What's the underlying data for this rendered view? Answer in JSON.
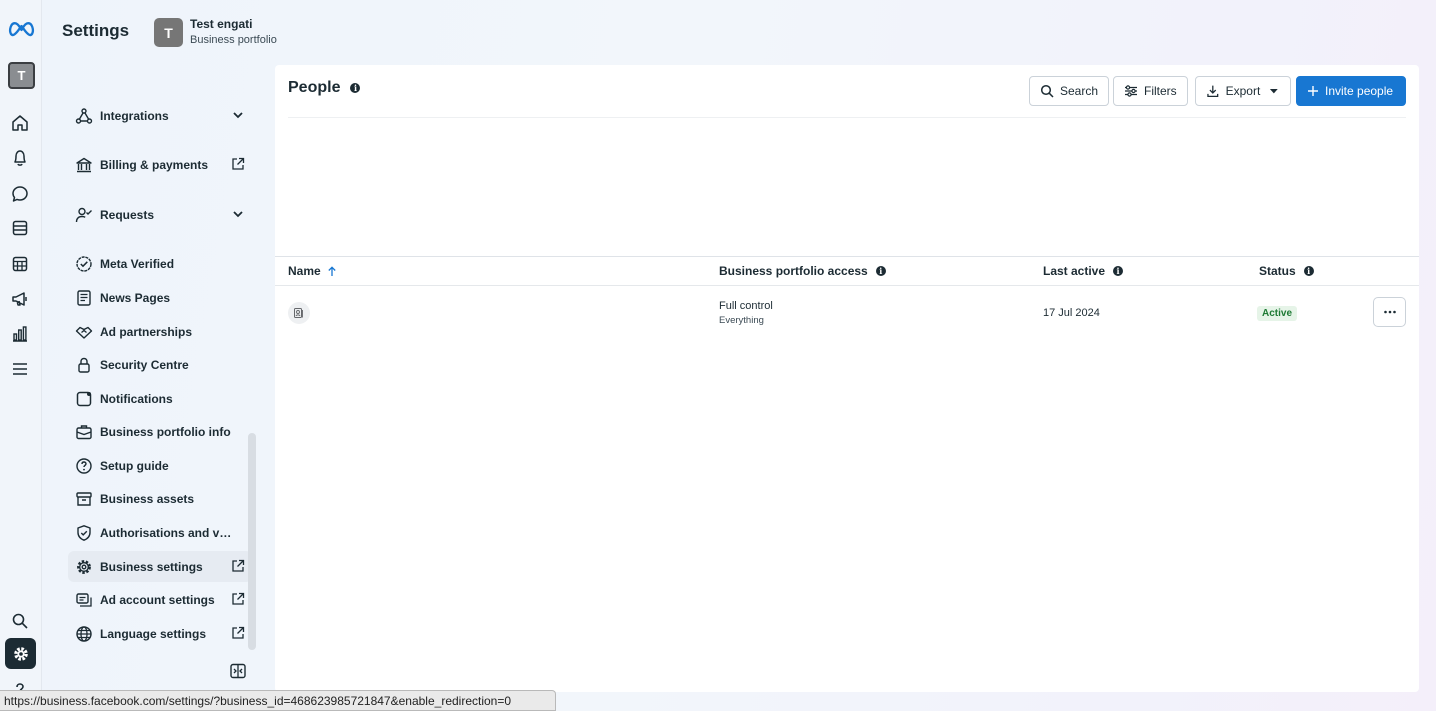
{
  "header": {
    "title": "Settings",
    "portfolio_initial": "T",
    "portfolio_name": "Test engati",
    "portfolio_type": "Business portfolio"
  },
  "rail": {
    "avatar_initial": "T",
    "icons": [
      "meta-logo-icon",
      "home-icon",
      "bell-icon",
      "chat-icon",
      "pages-icon",
      "table-icon",
      "megaphone-icon",
      "chart-icon",
      "menu-icon",
      "search-icon",
      "gear-icon",
      "help-icon"
    ]
  },
  "sidebar": {
    "items": [
      {
        "label": "Integrations",
        "icon": "integrations-icon",
        "trail": "chevron-down"
      },
      {
        "label": "Billing & payments",
        "icon": "bank-icon",
        "trail": "external"
      },
      {
        "label": "Requests",
        "icon": "person-check-icon",
        "trail": "chevron-down"
      },
      {
        "label": "Meta Verified",
        "icon": "verified-badge-icon",
        "trail": ""
      },
      {
        "label": "News Pages",
        "icon": "news-icon",
        "trail": ""
      },
      {
        "label": "Ad partnerships",
        "icon": "handshake-icon",
        "trail": ""
      },
      {
        "label": "Security Centre",
        "icon": "lock-icon",
        "trail": ""
      },
      {
        "label": "Notifications",
        "icon": "notification-square-icon",
        "trail": ""
      },
      {
        "label": "Business portfolio info",
        "icon": "briefcase-icon",
        "trail": ""
      },
      {
        "label": "Setup guide",
        "icon": "question-circle-icon",
        "trail": ""
      },
      {
        "label": "Business assets",
        "icon": "archive-box-icon",
        "trail": ""
      },
      {
        "label": "Authorisations and ver...",
        "icon": "shield-check-icon",
        "trail": ""
      },
      {
        "label": "Business settings",
        "icon": "gear-icon",
        "trail": "external"
      },
      {
        "label": "Ad account settings",
        "icon": "ad-account-icon",
        "trail": "external"
      },
      {
        "label": "Language settings",
        "icon": "globe-icon",
        "trail": "external"
      }
    ],
    "selected": "Business settings"
  },
  "main": {
    "title": "People",
    "buttons": {
      "search": "Search",
      "filters": "Filters",
      "export": "Export",
      "invite": "Invite people"
    },
    "table": {
      "columns": [
        "Name",
        "Business portfolio access",
        "Last active",
        "Status"
      ],
      "rows": [
        {
          "name": "",
          "access": "Full control",
          "access_detail": "Everything",
          "last_active": "17 Jul 2024",
          "status": "Active"
        }
      ]
    }
  },
  "statusbar": {
    "url": "https://business.facebook.com/settings/?business_id=468623985721847&enable_redirection=0"
  },
  "colors": {
    "primary": "#1877d2",
    "text": "#1c2b33",
    "active_badge_bg": "#e6f4e8",
    "active_badge_text": "#1e7a34"
  }
}
